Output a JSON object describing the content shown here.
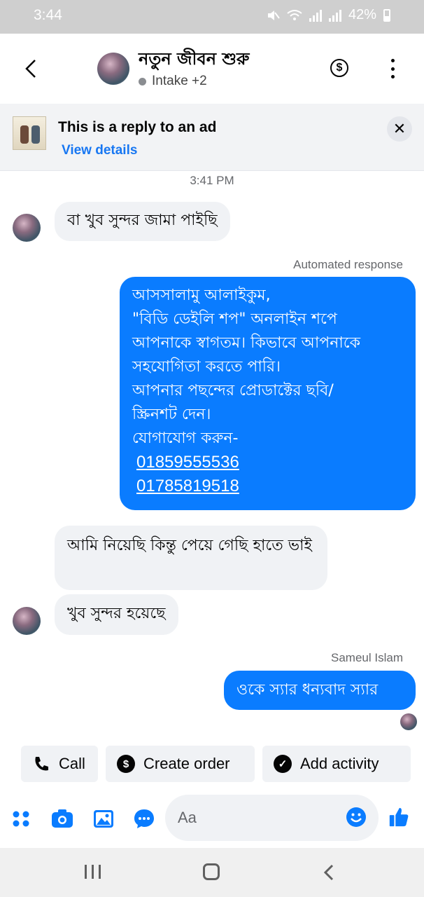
{
  "status_bar": {
    "time": "3:44",
    "battery": "42%"
  },
  "header": {
    "title": "নতুন জীবন শুরু",
    "subtitle": "Intake +2"
  },
  "ad_banner": {
    "title": "This is a reply to an ad",
    "link": "View details"
  },
  "timestamp": "3:41 PM",
  "messages": {
    "m1": "বা খুব সুন্দর জামা পাইছি",
    "m2_label": "Automated response",
    "m2_lines": [
      "আসসালামু আলাইকুম,",
      "\"বিডি ডেইলি শপ\" অনলাইন শপে",
      "আপনাকে স্বাগতম। কিভাবে আপনাকে",
      "সহযোগিতা করতে পারি।",
      "আপনার পছন্দের প্রোডাক্টের ছবি/",
      "স্ক্রিনশট দেন।",
      "যোগাযোগ করুন-"
    ],
    "m2_phones": [
      "01859555536",
      "01785819518"
    ],
    "m3": "আমি নিয়েছি কিন্তু পেয়ে গেছি হাতে ভাই",
    "m4": "খুব সুন্দর হয়েছে",
    "m5_label": "Sameul Islam",
    "m5": "ওকে স্যার ধন্যবাদ স্যার"
  },
  "actions": {
    "call": "Call",
    "create_order": "Create order",
    "add_activity": "Add activity"
  },
  "composer": {
    "placeholder": "Aa"
  },
  "colors": {
    "accent": "#0a7cff",
    "bubble_in": "#f0f2f5"
  }
}
